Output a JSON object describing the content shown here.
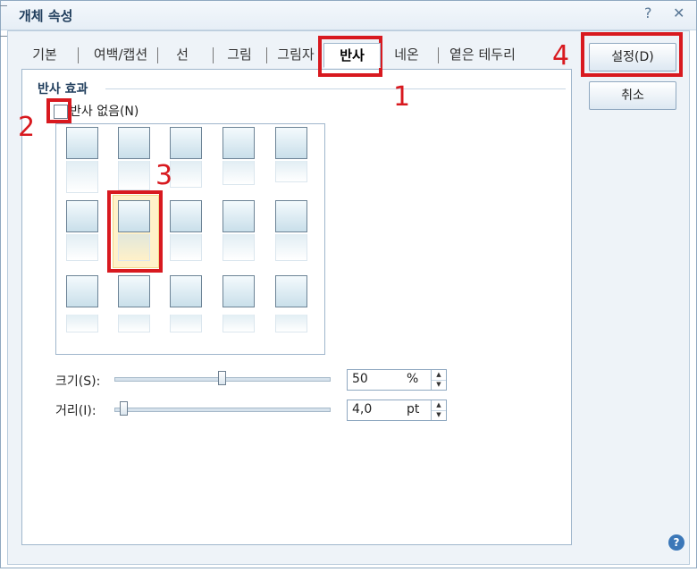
{
  "window": {
    "title": "개체 속성",
    "help_glyph": "?",
    "close_glyph": "✕"
  },
  "tabs": [
    {
      "label": "기본",
      "active": false
    },
    {
      "label": "여백/캡션",
      "active": false
    },
    {
      "label": "선",
      "active": false
    },
    {
      "label": "그림",
      "active": false
    },
    {
      "label": "그림자",
      "active": false
    },
    {
      "label": "반사",
      "active": true
    },
    {
      "label": "네온",
      "active": false
    },
    {
      "label": "옅은 테두리",
      "active": false
    }
  ],
  "reflection": {
    "section_title": "반사 효과",
    "no_reflection_label": "반사 없음(N)",
    "no_reflection_checked": false,
    "preset_rows": 3,
    "preset_cols": 5,
    "selected_preset": {
      "row": 2,
      "col": 2
    }
  },
  "size_control": {
    "label": "크기(S):",
    "value": "50",
    "unit": "%",
    "level_percent": 50
  },
  "distance_control": {
    "label": "거리(I):",
    "value": "4,0",
    "unit": "pt",
    "level_percent": 4
  },
  "buttons": {
    "ok_label": "설정(D)",
    "cancel_label": "취소",
    "help_glyph": "?"
  },
  "annotations": {
    "marker_1": "1",
    "marker_2": "2",
    "marker_3": "3",
    "marker_4": "4",
    "color": "#d8191f"
  }
}
